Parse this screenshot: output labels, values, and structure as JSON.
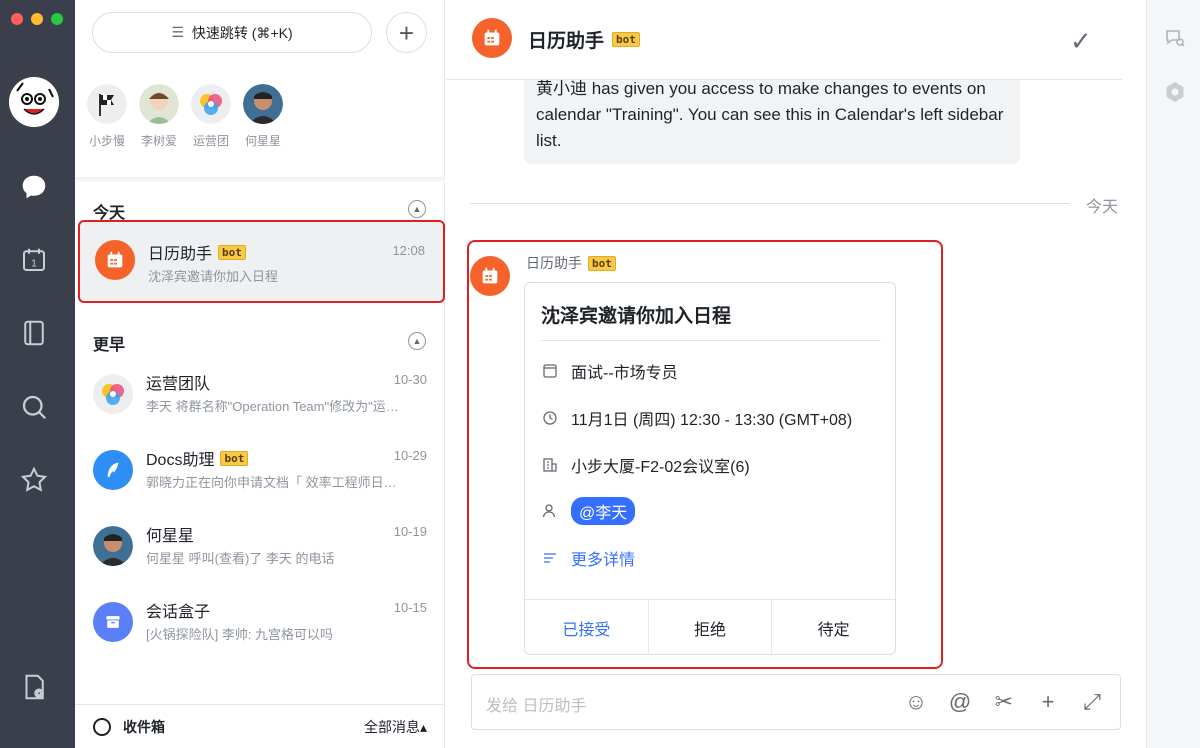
{
  "search": {
    "label": "快速跳转 (⌘+K)"
  },
  "favorites": [
    {
      "name": "小步慢"
    },
    {
      "name": "李树爱"
    },
    {
      "name": "运营团"
    },
    {
      "name": "何星星"
    }
  ],
  "sections": {
    "today": "今天",
    "earlier": "更早"
  },
  "chats_today": [
    {
      "title": "日历助手",
      "bot": "bot",
      "time": "12:08",
      "preview": "沈泽宾邀请你加入日程"
    }
  ],
  "chats_earlier": [
    {
      "title": "运营团队",
      "bot": "",
      "time": "10-30",
      "preview": "李天 将群名称\"Operation Team\"修改为\"运营团队\""
    },
    {
      "title": "Docs助理",
      "bot": "bot",
      "time": "10-29",
      "preview": "郭晓力正在向你申请文档「 效率工程师日程安排」"
    },
    {
      "title": "何星星",
      "bot": "",
      "time": "10-19",
      "preview": "何星星 呼叫(查看)了 李天 的电话"
    },
    {
      "title": "会话盒子",
      "bot": "",
      "time": "10-15",
      "preview": "[火锅探险队] 李帅: 九宫格可以吗"
    }
  ],
  "footer": {
    "inbox": "收件箱",
    "filter": "全部消息▴"
  },
  "chat": {
    "title": "日历助手",
    "bot": "bot",
    "previous_message": "黄小迪 has given you access to make changes to events on calendar \"Training\". You can see this in Calendar's left sidebar list.",
    "date_divider": "今天",
    "sender": "日历助手",
    "sender_bot": "bot",
    "card": {
      "title": "沈泽宾邀请你加入日程",
      "event": "面试--市场专员",
      "time": "11月1日 (周四) 12:30 - 13:30 (GMT+08)",
      "location": "小步大厦-F2-02会议室(6)",
      "attendee": "@李天",
      "more": "更多详情",
      "actions": {
        "accept": "已接受",
        "decline": "拒绝",
        "tentative": "待定"
      }
    },
    "input_placeholder": "发给 日历助手"
  },
  "colors": {
    "rail": "#3a3f4b",
    "accent": "#3370ff",
    "calendar_orange": "#f5632a",
    "highlight_red": "#e02020"
  }
}
